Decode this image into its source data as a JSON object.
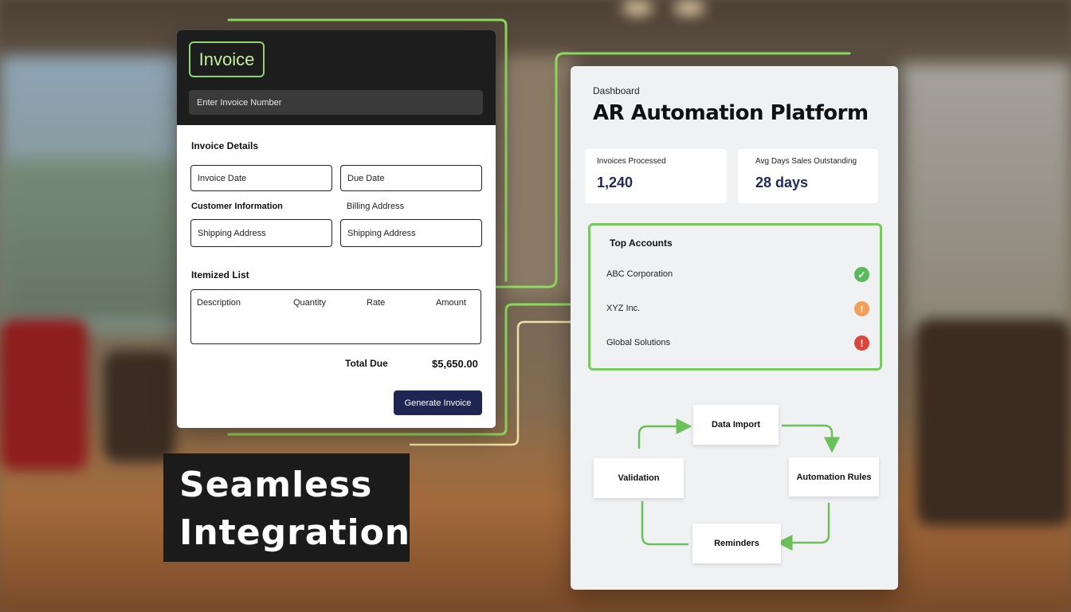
{
  "colors": {
    "accent_green": "#79c760",
    "navy": "#1f2652",
    "dark": "#1d1d1d"
  },
  "invoice": {
    "title": "Invoice",
    "number_placeholder": "Enter Invoice Number",
    "details_title": "Invoice Details",
    "invoice_date": "Invoice Date",
    "due_date": "Due Date",
    "customer_info": "Customer Information",
    "billing_address": "Billing Address",
    "shipping_address_1": "Shipping Address",
    "shipping_address_2": "Shipping Address",
    "itemized_title": "Itemized List",
    "columns": [
      "Description",
      "Quantity",
      "Rate",
      "Amount"
    ],
    "total_label": "Total Due",
    "total_value": "$5,650.00",
    "generate_button": "Generate Invoice"
  },
  "caption": {
    "line1": "Seamless",
    "line2": "Integration"
  },
  "dashboard": {
    "breadcrumb": "Dashboard",
    "title": "AR Automation Platform",
    "stats": [
      {
        "label": "Invoices Processed",
        "value": "1,240"
      },
      {
        "label": "Avg Days Sales Outstanding",
        "value": "28 days"
      }
    ],
    "accounts_title": "Top Accounts",
    "accounts": [
      {
        "name": "ABC Corporation",
        "status": "check-icon",
        "color": "#5cb85c",
        "glyph": "✓"
      },
      {
        "name": "XYZ Inc.",
        "status": "warning-icon",
        "color": "#f0a05a",
        "glyph": "!"
      },
      {
        "name": "Global Solutions",
        "status": "alert-icon",
        "color": "#d9463b",
        "glyph": "!"
      }
    ],
    "workflow": {
      "data_import": "Data Import",
      "automation_rules": "Automation Rules",
      "reminders": "Reminders",
      "validation": "Validation"
    }
  }
}
